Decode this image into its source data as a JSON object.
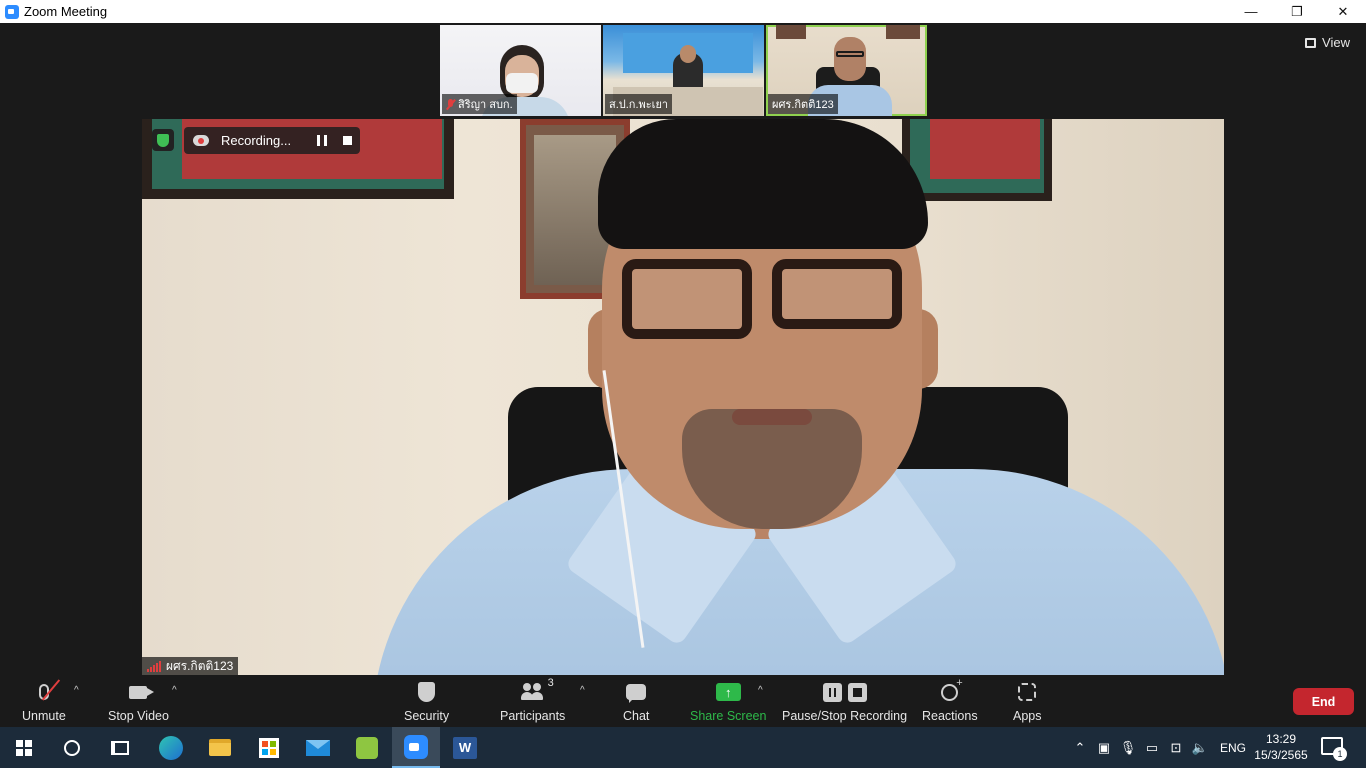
{
  "window": {
    "title": "Zoom Meeting",
    "controls": {
      "minimize": "—",
      "restore": "❐",
      "close": "✕"
    }
  },
  "view_button": {
    "label": "View",
    "icon": "grid-icon"
  },
  "thumbnails": [
    {
      "name": "สิริญา สบก.",
      "muted": true
    },
    {
      "name": "ส.ป.ก.พะเยา",
      "muted": false
    },
    {
      "name": "ผศร.กิตติ123",
      "muted": false,
      "active_speaker": true
    }
  ],
  "main_video": {
    "participant_name": "ผศร.กิตติ123",
    "recording": {
      "label": "Recording..."
    }
  },
  "toolbar": {
    "unmute": "Unmute",
    "stop_video": "Stop Video",
    "security": "Security",
    "participants": "Participants",
    "participants_count": "3",
    "chat": "Chat",
    "share_screen": "Share Screen",
    "pause_stop_recording": "Pause/Stop Recording",
    "reactions": "Reactions",
    "apps": "Apps",
    "end": "End"
  },
  "taskbar": {
    "apps": [
      "start",
      "search",
      "task-view",
      "edge",
      "file-explorer",
      "store",
      "mail",
      "green-app",
      "zoom",
      "word"
    ],
    "tray": {
      "language": "ENG",
      "time": "13:29",
      "date": "15/3/2565",
      "notification_count": "1"
    }
  },
  "colors": {
    "background": "#1a1a1a",
    "share_green": "#2eb94a",
    "end_red": "#c4262e",
    "active_speaker_border": "#8fd14f",
    "taskbar": "#1c2b3a"
  }
}
